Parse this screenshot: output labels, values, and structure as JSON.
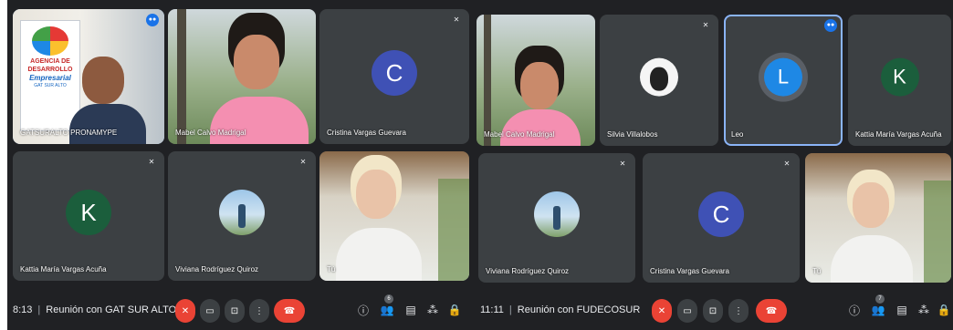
{
  "left": {
    "tiles": [
      {
        "name": "GATSURALTO PRONAMYPE"
      },
      {
        "name": "Mabel Calvo Madrigal"
      },
      {
        "name": "Cristina Vargas Guevara",
        "initial": "C"
      },
      {
        "name": "Kattia María Vargas Acuña",
        "initial": "K"
      },
      {
        "name": "Viviana Rodríguez Quiroz"
      },
      {
        "name": "Tú"
      }
    ],
    "banner_text": [
      "AGENCIA DE",
      "DESARROLLO",
      "Empresarial",
      "GAT SUR ALTO"
    ],
    "bar": {
      "time": "8:13",
      "meeting": "Reunión con GAT SUR ALTO",
      "participants": "6"
    }
  },
  "right": {
    "tiles": [
      {
        "name": "Mabel Calvo Madrigal"
      },
      {
        "name": "Silvia Villalobos"
      },
      {
        "name": "Leo",
        "initial": "L"
      },
      {
        "name": "Kattia María Vargas Acuña",
        "initial": "K"
      },
      {
        "name": "Viviana Rodríguez Quiroz"
      },
      {
        "name": "Cristina Vargas Guevara",
        "initial": "C"
      },
      {
        "name": "Tú"
      }
    ],
    "bar": {
      "time": "11:11",
      "meeting": "Reunión con FUDECOSUR",
      "participants": "7"
    }
  },
  "icons": {
    "mic_off": "mic-off-icon",
    "camera": "camera-icon",
    "present": "present-icon",
    "more": "more-options-icon",
    "hangup": "hangup-icon",
    "info": "info-icon",
    "people": "people-icon",
    "chat": "chat-icon",
    "activities": "activities-icon",
    "lock": "host-controls-icon",
    "speaking": "speaking-indicator-icon"
  },
  "colors": {
    "background": "#202124",
    "tile": "#3c4043",
    "accent": "#8ab4f8",
    "danger": "#ea4335",
    "avatar_c": "#3f51b5",
    "avatar_k": "#1b5e3c",
    "avatar_l": "#1e88e5"
  }
}
